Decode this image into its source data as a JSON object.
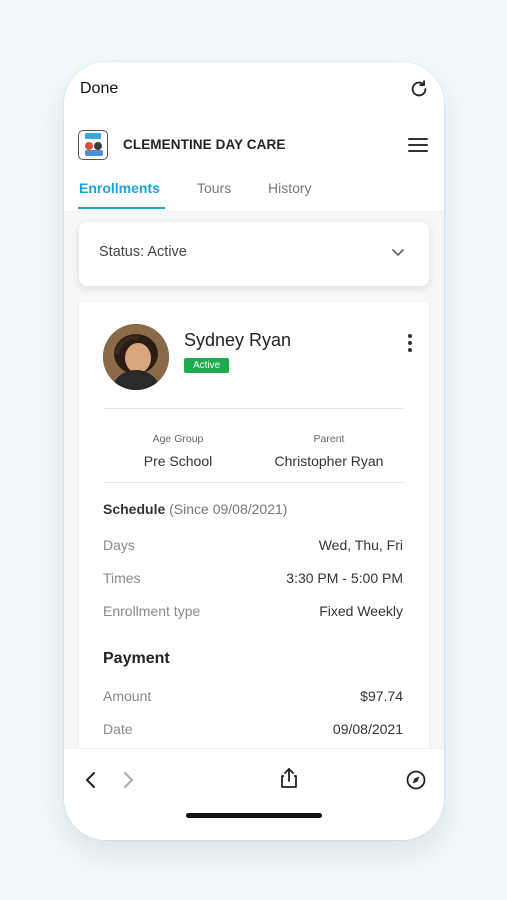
{
  "browser": {
    "done_label": "Done",
    "reload_icon": "reload-icon"
  },
  "header": {
    "brand": "CLEMENTINE DAY CARE",
    "menu_icon": "hamburger-menu-icon"
  },
  "tabs": [
    {
      "label": "Enrollments",
      "active": true
    },
    {
      "label": "Tours",
      "active": false
    },
    {
      "label": "History",
      "active": false
    }
  ],
  "status_filter": {
    "label": "Status: Active",
    "icon": "chevron-down-icon"
  },
  "child": {
    "name": "Sydney Ryan",
    "badge": "Active",
    "age_group_label": "Age Group",
    "age_group": "Pre School",
    "parent_label": "Parent",
    "parent": "Christopher Ryan"
  },
  "schedule": {
    "title": "Schedule",
    "since": "(Since 09/08/2021)",
    "rows": [
      {
        "label": "Days",
        "value": "Wed, Thu, Fri"
      },
      {
        "label": "Times",
        "value": "3:30 PM - 5:00 PM"
      },
      {
        "label": "Enrollment type",
        "value": "Fixed Weekly"
      }
    ]
  },
  "payment": {
    "title": "Payment",
    "rows": [
      {
        "label": "Amount",
        "value": "$97.74"
      },
      {
        "label": "Date",
        "value": "09/08/2021"
      }
    ]
  },
  "colors": {
    "accent": "#1aa3d6",
    "badge_green": "#1faa4e",
    "background": "#f1fafc"
  }
}
